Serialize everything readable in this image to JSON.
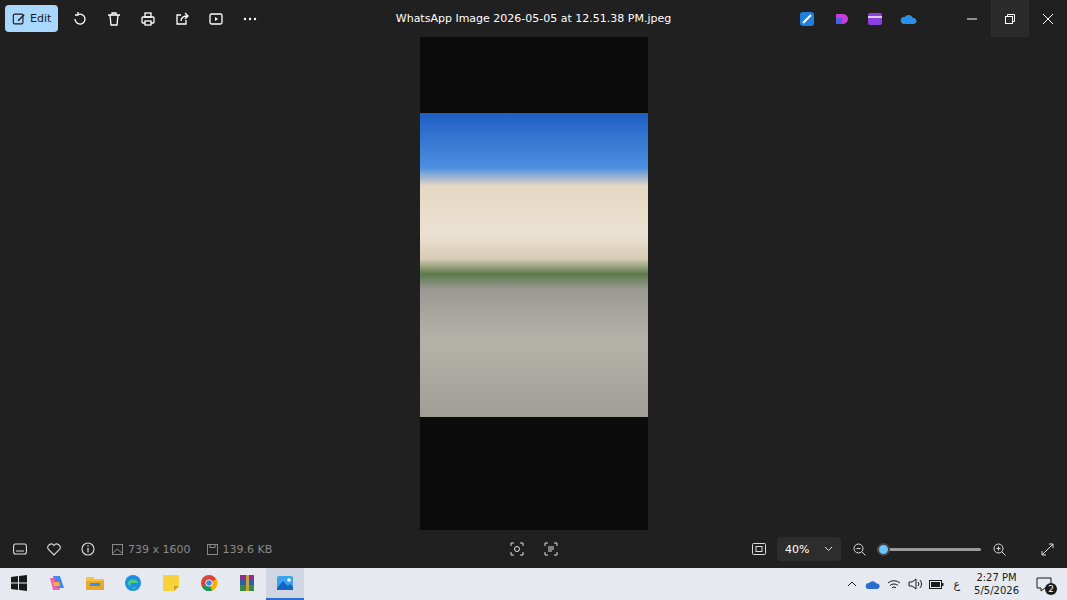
{
  "window": {
    "title": "WhatsApp Image 2026-05-05 at 12.51.38 PM.jpeg"
  },
  "toolbar": {
    "edit_label": "Edit"
  },
  "bottom_bar": {
    "favorite": false,
    "dimensions": "739 x 1600",
    "file_size": "139.6 KB",
    "zoom": "40%",
    "zoom_level": 0.06
  },
  "taskbar": {
    "apps": [
      {
        "kind": "copilot",
        "active": false
      },
      {
        "kind": "explorer",
        "active": false
      },
      {
        "kind": "edge",
        "active": false
      },
      {
        "kind": "sticky-notes",
        "active": false
      },
      {
        "kind": "chrome",
        "active": false
      },
      {
        "kind": "winrar",
        "active": false
      },
      {
        "kind": "photos",
        "active": true
      }
    ],
    "language": "ع",
    "time": "2:27 PM",
    "date": "5/5/2026",
    "notifications": "2"
  }
}
